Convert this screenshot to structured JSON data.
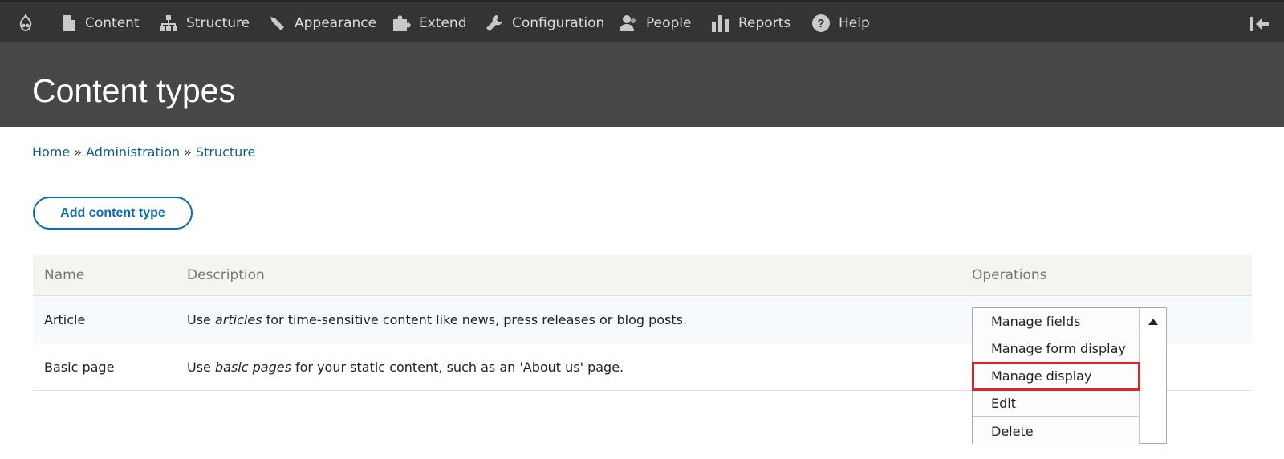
{
  "toolbar": {
    "items": [
      {
        "label": "Content",
        "icon": "document-icon"
      },
      {
        "label": "Structure",
        "icon": "sitemap-icon"
      },
      {
        "label": "Appearance",
        "icon": "paintbrush-icon"
      },
      {
        "label": "Extend",
        "icon": "puzzle-icon"
      },
      {
        "label": "Configuration",
        "icon": "wrench-icon"
      },
      {
        "label": "People",
        "icon": "person-icon"
      },
      {
        "label": "Reports",
        "icon": "bar-chart-icon"
      },
      {
        "label": "Help",
        "icon": "help-icon"
      }
    ]
  },
  "header": {
    "title": "Content types"
  },
  "breadcrumb": {
    "home": "Home",
    "sep": "»",
    "administration": "Administration",
    "structure": "Structure"
  },
  "actions": {
    "add_label": "Add content type"
  },
  "table": {
    "headers": {
      "name": "Name",
      "description": "Description",
      "operations": "Operations"
    },
    "rows": [
      {
        "name": "Article",
        "desc_pre": "Use ",
        "desc_em": "articles",
        "desc_post": " for time-sensitive content like news, press releases or blog posts."
      },
      {
        "name": "Basic page",
        "desc_pre": "Use ",
        "desc_em": "basic pages",
        "desc_post": " for your static content, such as an 'About us' page."
      }
    ]
  },
  "dropbutton": {
    "items": [
      "Manage fields",
      "Manage form display",
      "Manage display",
      "Edit",
      "Delete"
    ],
    "highlighted": "Manage display"
  },
  "colors": {
    "toolbar_bg": "#343434",
    "header_bg": "#474747",
    "link": "#0f5a9c",
    "highlight": "#d9262b"
  }
}
